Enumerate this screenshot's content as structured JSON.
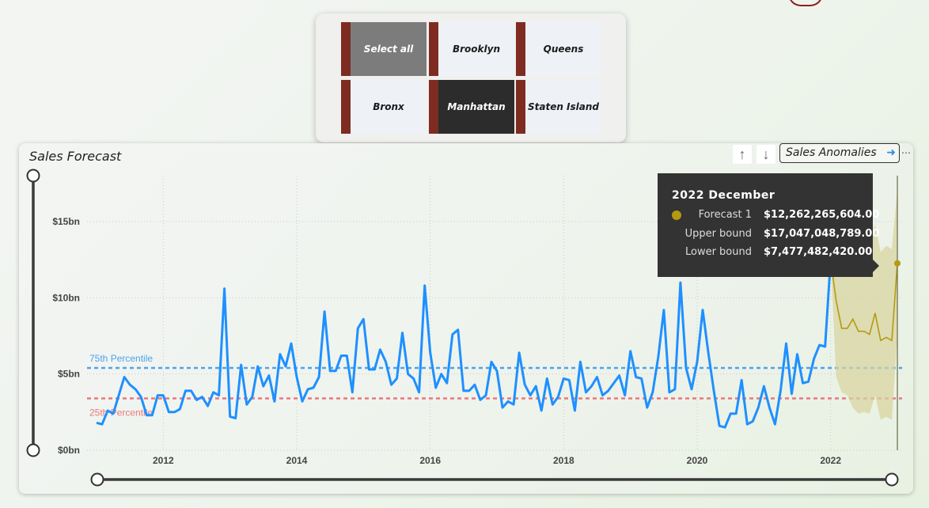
{
  "slicer": {
    "tiles": [
      {
        "label": "Select all",
        "state": "partial"
      },
      {
        "label": "Brooklyn",
        "state": "off"
      },
      {
        "label": "Queens",
        "state": "off"
      },
      {
        "label": "Bronx",
        "state": "off"
      },
      {
        "label": "Manhattan",
        "state": "on"
      },
      {
        "label": "Staten Island",
        "state": "off"
      }
    ]
  },
  "visual": {
    "title": "Sales Forecast",
    "anomalies_button": "Sales Anomalies",
    "sort_up_icon": "arrow-up-icon",
    "sort_down_icon": "arrow-down-icon"
  },
  "tooltip": {
    "title": "2022 December",
    "rows": [
      {
        "label": "Forecast 1",
        "value": "$12,262,265,604.00"
      },
      {
        "label": "Upper bound",
        "value": "$17,047,048,789.00"
      },
      {
        "label": "Lower bound",
        "value": "$7,477,482,420.00"
      }
    ]
  },
  "colors": {
    "accent": "#7e2c22",
    "actual_line": "#1e90ff",
    "forecast_line": "#b59a10",
    "forecast_band": "#d8d4a0",
    "p75": "#4da3f0",
    "p25": "#e8787e"
  },
  "chart_data": {
    "type": "line",
    "title": "Sales Forecast",
    "x_start": "2011-01",
    "x_end": "2022-12",
    "x_ticks": [
      "2012",
      "2014",
      "2016",
      "2018",
      "2020",
      "2022"
    ],
    "y_ticks": [
      "$0bn",
      "$5bn",
      "$10bn",
      "$15bn"
    ],
    "y_tick_values": [
      0,
      5,
      10,
      15
    ],
    "ylim": [
      0,
      15
    ],
    "grid": true,
    "series": [
      {
        "name": "",
        "values": [
          1.8,
          1.7,
          2.6,
          2.4,
          3.6,
          4.8,
          4.3,
          4.0,
          3.5,
          2.3,
          2.3,
          3.6,
          3.6,
          2.5,
          2.5,
          2.7,
          3.9,
          3.9,
          3.3,
          3.5,
          2.9,
          3.8,
          3.6,
          10.6,
          2.2,
          2.1,
          5.6,
          3.0,
          3.5,
          5.5,
          4.2,
          4.9,
          3.2,
          6.3,
          5.5,
          7.0,
          4.8,
          3.2,
          4.0,
          4.1,
          4.8,
          9.1,
          5.2,
          5.2,
          6.2,
          6.2,
          3.8,
          8.0,
          8.6,
          5.3,
          5.3,
          6.6,
          5.8,
          4.3,
          4.7,
          7.7,
          5.0,
          4.7,
          3.8,
          10.8,
          6.4,
          4.1,
          5.0,
          4.4,
          7.6,
          7.9,
          3.9,
          3.9,
          4.3,
          3.3,
          3.6,
          5.8,
          5.2,
          2.8,
          3.2,
          3.0,
          6.4,
          4.3,
          3.6,
          4.2,
          2.6,
          4.7,
          3.0,
          3.5,
          4.7,
          4.6,
          2.6,
          5.8,
          3.8,
          4.2,
          4.8,
          3.6,
          3.9,
          4.4,
          4.9,
          3.6,
          6.5,
          4.8,
          4.7,
          2.8,
          3.8,
          6.1,
          9.2,
          3.8,
          4.0,
          11.0,
          5.4,
          4.0,
          5.8,
          9.2,
          6.4,
          3.9,
          1.6,
          1.5,
          2.4,
          2.4,
          4.6,
          1.7,
          1.9,
          2.8,
          4.2,
          2.8,
          1.7,
          3.9,
          7.0,
          3.7,
          6.3,
          4.4,
          4.5,
          6.0,
          6.9,
          6.8,
          12.5
        ]
      },
      {
        "name": "Forecast 1",
        "values": [
          9.8,
          8.0,
          8.0,
          8.6,
          7.8,
          7.8,
          7.6,
          9.0,
          7.2,
          7.4,
          7.2,
          12.26
        ]
      }
    ],
    "upper_bound": [
      16.0,
      14.0,
      13.5,
      14.5,
      13.5,
      13.5,
      13.5,
      14.8,
      13.0,
      13.4,
      13.2,
      17.05
    ],
    "lower_bound": [
      4.8,
      3.8,
      3.6,
      2.8,
      2.4,
      2.5,
      2.4,
      3.6,
      2.0,
      2.2,
      2.0,
      7.48
    ],
    "reference_lines": [
      {
        "label": "75th Percentile",
        "value": 5.4
      },
      {
        "label": "25th Percentile",
        "value": 3.4
      }
    ]
  }
}
